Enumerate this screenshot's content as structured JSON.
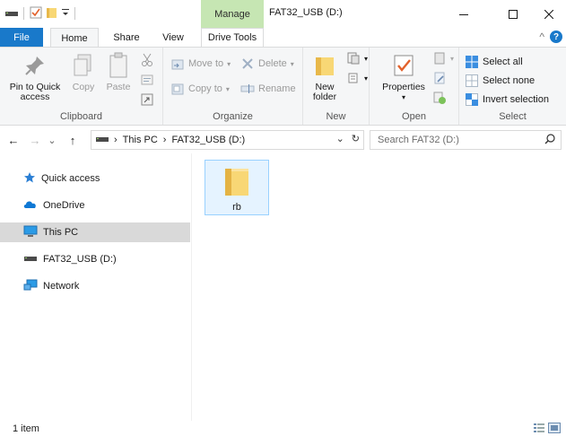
{
  "titlebar": {
    "contextual_tab": "Manage",
    "window_title": "FAT32_USB (D:)",
    "minimize": "—",
    "maximize": "☐",
    "close": "✕"
  },
  "tabs": {
    "file": "File",
    "home": "Home",
    "share": "Share",
    "view": "View",
    "drive_tools": "Drive Tools",
    "collapse": "^",
    "help": "?"
  },
  "ribbon": {
    "clipboard": {
      "label": "Clipboard",
      "pin": "Pin to Quick access",
      "copy": "Copy",
      "paste": "Paste"
    },
    "organize": {
      "label": "Organize",
      "move_to": "Move to",
      "copy_to": "Copy to",
      "delete": "Delete",
      "rename": "Rename"
    },
    "new": {
      "label": "New",
      "new_folder": "New folder"
    },
    "open": {
      "label": "Open",
      "properties": "Properties"
    },
    "select": {
      "label": "Select",
      "select_all": "Select all",
      "select_none": "Select none",
      "invert_selection": "Invert selection"
    }
  },
  "address": {
    "back": "←",
    "forward": "→",
    "recent": "⌄",
    "up": "↑",
    "crumbs": [
      "This PC",
      "FAT32_USB (D:)"
    ],
    "separator": "›",
    "dropdown": "⌄",
    "refresh": "↻"
  },
  "search": {
    "placeholder": "Search FAT32 (D:)"
  },
  "navpane": {
    "items": [
      {
        "label": "Quick access",
        "icon": "star-icon"
      },
      {
        "label": "OneDrive",
        "icon": "cloud-icon"
      },
      {
        "label": "This PC",
        "icon": "monitor-icon"
      },
      {
        "label": "FAT32_USB (D:)",
        "icon": "usb-drive-icon"
      },
      {
        "label": "Network",
        "icon": "network-icon"
      }
    ]
  },
  "content": {
    "items": [
      {
        "name": "rb",
        "icon": "folder-icon"
      }
    ]
  },
  "status": {
    "count": "1 item"
  },
  "colors": {
    "accent": "#1979ca",
    "manage_tab": "#c6e6b3",
    "selection": "#e5f3ff",
    "folder": "#f8d775"
  }
}
